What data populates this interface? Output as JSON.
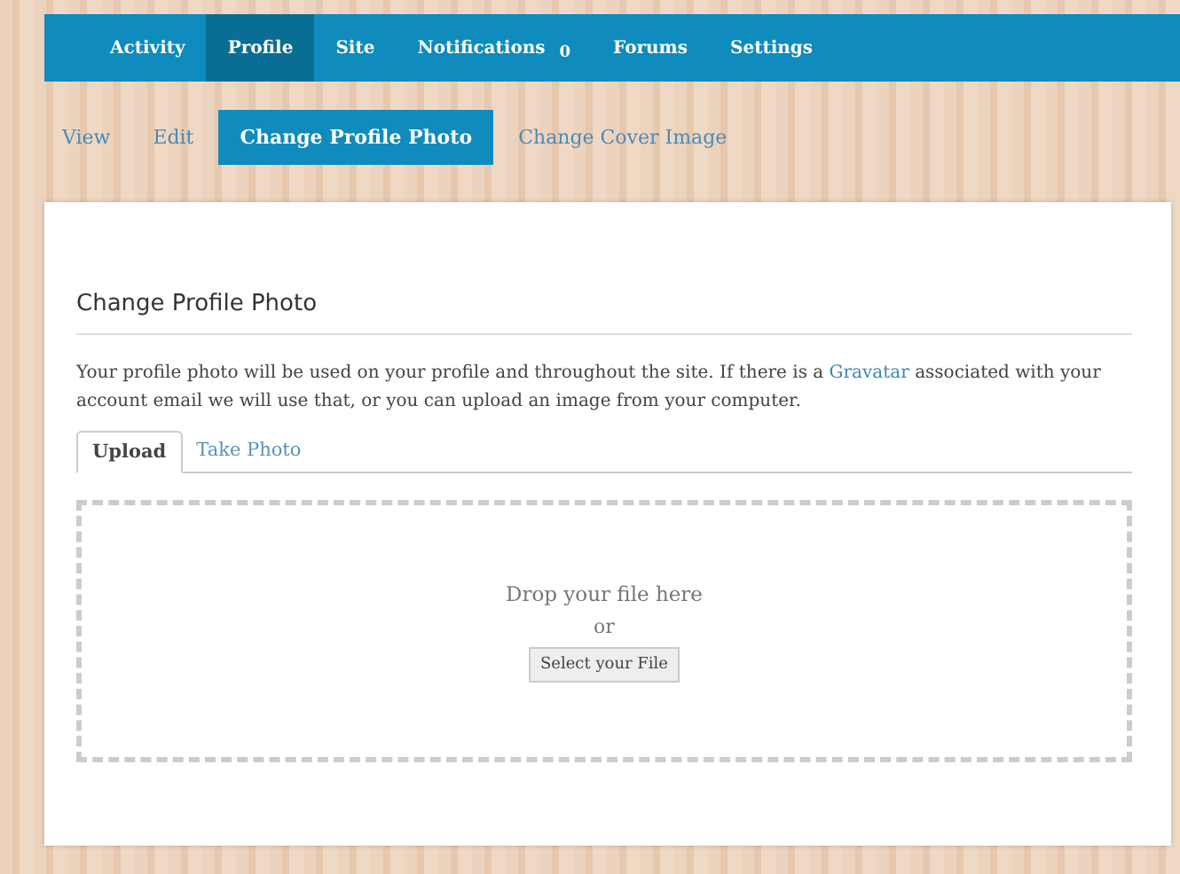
{
  "nav": [
    {
      "label": "Activity",
      "selected": false
    },
    {
      "label": "Profile",
      "selected": true
    },
    {
      "label": "Site",
      "selected": false
    },
    {
      "label": "Notifications",
      "count": "0",
      "selected": false
    },
    {
      "label": "Forums",
      "selected": false
    },
    {
      "label": "Settings",
      "selected": false
    }
  ],
  "subnav": [
    {
      "label": "View",
      "selected": false
    },
    {
      "label": "Edit",
      "selected": false
    },
    {
      "label": "Change Profile Photo",
      "selected": true
    },
    {
      "label": "Change Cover Image",
      "selected": false
    }
  ],
  "card": {
    "title": "Change Profile Photo",
    "intro": {
      "before": "Your profile photo will be used on your profile and throughout the site. If there is a ",
      "link": "Gravatar",
      "after": " associated with your account email we will use that, or you can upload an image from your computer."
    },
    "tabs": [
      {
        "label": "Upload",
        "selected": true
      },
      {
        "label": "Take Photo",
        "selected": false
      }
    ],
    "dropzone": {
      "message": "Drop your file here",
      "or": "or",
      "button": "Select your File"
    }
  }
}
